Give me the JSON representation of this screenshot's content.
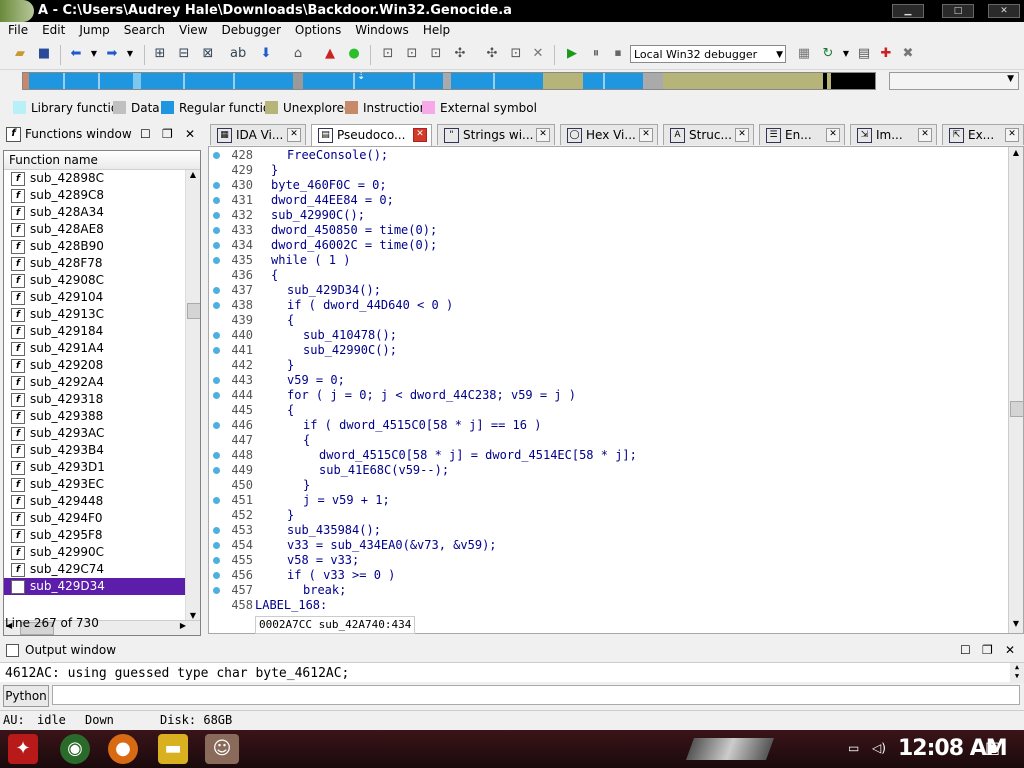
{
  "window": {
    "title": "A - C:\\Users\\Audrey Hale\\Downloads\\Backdoor.Win32.Genocide.a"
  },
  "menu": [
    "File",
    "Edit",
    "Jump",
    "Search",
    "View",
    "Debugger",
    "Options",
    "Windows",
    "Help"
  ],
  "toolbar": {
    "debugger_select": "Local Win32 debugger"
  },
  "legend": [
    {
      "label": "Library function",
      "color": "#b7f0f7"
    },
    {
      "label": "Data",
      "color": "#c0c0c0"
    },
    {
      "label": "Regular function",
      "color": "#1e96e0"
    },
    {
      "label": "Unexplored",
      "color": "#b7b47a"
    },
    {
      "label": "Instruction",
      "color": "#c68a6a"
    },
    {
      "label": "External symbol",
      "color": "#f7a8e8"
    }
  ],
  "functions_window": {
    "title": "Functions window",
    "column_header": "Function name",
    "items": [
      "sub_42898C",
      "sub_4289C8",
      "sub_428A34",
      "sub_428AE8",
      "sub_428B90",
      "sub_428F78",
      "sub_42908C",
      "sub_429104",
      "sub_42913C",
      "sub_429184",
      "sub_4291A4",
      "sub_429208",
      "sub_4292A4",
      "sub_429318",
      "sub_429388",
      "sub_4293AC",
      "sub_4293B4",
      "sub_4293D1",
      "sub_4293EC",
      "sub_429448",
      "sub_4294F0",
      "sub_4295F8",
      "sub_42990C",
      "sub_429C74",
      "sub_429D34"
    ],
    "selected": "sub_429D34",
    "line_info": "Line 267 of 730"
  },
  "tabs": [
    {
      "label": "IDA Vi...",
      "icon": "graph-icon"
    },
    {
      "label": "Pseudoco...",
      "icon": "pseudocode-icon",
      "active": true
    },
    {
      "label": "Strings wi...",
      "icon": "strings-icon"
    },
    {
      "label": "Hex Vi...",
      "icon": "hex-icon"
    },
    {
      "label": "Struc...",
      "icon": "struct-icon"
    },
    {
      "label": "En...",
      "icon": "enum-icon"
    },
    {
      "label": "Im...",
      "icon": "imports-icon"
    },
    {
      "label": "Ex...",
      "icon": "exports-icon"
    }
  ],
  "code": [
    {
      "ln": "428",
      "dot": true,
      "indent": 2,
      "text": "FreeConsole();"
    },
    {
      "ln": "429",
      "dot": false,
      "indent": 1,
      "text": "}"
    },
    {
      "ln": "430",
      "dot": true,
      "indent": 1,
      "text": "byte_460F0C = 0;"
    },
    {
      "ln": "431",
      "dot": true,
      "indent": 1,
      "text": "dword_44EE84 = 0;"
    },
    {
      "ln": "432",
      "dot": true,
      "indent": 1,
      "text": "sub_42990C();"
    },
    {
      "ln": "433",
      "dot": true,
      "indent": 1,
      "text": "dword_450850 = time(0);"
    },
    {
      "ln": "434",
      "dot": true,
      "indent": 1,
      "text": "dword_46002C = time(0);"
    },
    {
      "ln": "435",
      "dot": true,
      "indent": 1,
      "text": "while ( 1 )"
    },
    {
      "ln": "436",
      "dot": false,
      "indent": 1,
      "text": "{"
    },
    {
      "ln": "437",
      "dot": true,
      "indent": 2,
      "text": "sub_429D34();"
    },
    {
      "ln": "438",
      "dot": true,
      "indent": 2,
      "text": "if ( dword_44D640 < 0 )"
    },
    {
      "ln": "439",
      "dot": false,
      "indent": 2,
      "text": "{"
    },
    {
      "ln": "440",
      "dot": true,
      "indent": 3,
      "text": "sub_410478();"
    },
    {
      "ln": "441",
      "dot": true,
      "indent": 3,
      "text": "sub_42990C();"
    },
    {
      "ln": "442",
      "dot": false,
      "indent": 2,
      "text": "}"
    },
    {
      "ln": "443",
      "dot": true,
      "indent": 2,
      "text": "v59 = 0;"
    },
    {
      "ln": "444",
      "dot": true,
      "indent": 2,
      "text": "for ( j = 0; j < dword_44C238; v59 = j )"
    },
    {
      "ln": "445",
      "dot": false,
      "indent": 2,
      "text": "{"
    },
    {
      "ln": "446",
      "dot": true,
      "indent": 3,
      "text": "if ( dword_4515C0[58 * j] == 16 )"
    },
    {
      "ln": "447",
      "dot": false,
      "indent": 3,
      "text": "{"
    },
    {
      "ln": "448",
      "dot": true,
      "indent": 4,
      "text": "dword_4515C0[58 * j] = dword_4514EC[58 * j];"
    },
    {
      "ln": "449",
      "dot": true,
      "indent": 4,
      "text": "sub_41E68C(v59--);"
    },
    {
      "ln": "450",
      "dot": false,
      "indent": 3,
      "text": "}"
    },
    {
      "ln": "451",
      "dot": true,
      "indent": 3,
      "text": "j = v59 + 1;"
    },
    {
      "ln": "452",
      "dot": false,
      "indent": 2,
      "text": "}"
    },
    {
      "ln": "453",
      "dot": true,
      "indent": 2,
      "text": "sub_435984();"
    },
    {
      "ln": "454",
      "dot": true,
      "indent": 2,
      "text": "v33 = sub_434EA0(&v73, &v59);"
    },
    {
      "ln": "455",
      "dot": true,
      "indent": 2,
      "text": "v58 = v33;"
    },
    {
      "ln": "456",
      "dot": true,
      "indent": 2,
      "text": "if ( v33 >= 0 )"
    },
    {
      "ln": "457",
      "dot": true,
      "indent": 3,
      "text": "break;"
    },
    {
      "ln": "458",
      "dot": false,
      "indent": 0,
      "text": "LABEL_168:"
    }
  ],
  "code_status": "0002A7CC sub_42A740:434",
  "output": {
    "title": "Output window",
    "text": "4612AC: using guessed type char byte_4612AC;",
    "python_button": "Python"
  },
  "status": {
    "au": "AU:",
    "state": "idle",
    "dir": "Down",
    "disk": "Disk: 68GB"
  },
  "taskbar": {
    "clock": "12:08 AM"
  }
}
